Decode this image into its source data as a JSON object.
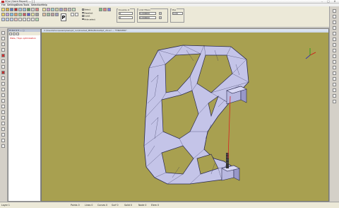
{
  "window": {
    "title": "SQui (Saint Report) — [ ]",
    "minimize_glyph": "–",
    "maximize_glyph": "□",
    "close_glyph": "✕"
  },
  "menu": [
    "File",
    "Settings",
    "Show",
    "Tools",
    "Selection",
    "Help"
  ],
  "toolbar": {
    "p_label": "P",
    "radios": [
      {
        "label": "Select",
        "selected": true
      },
      {
        "label": "Deselect",
        "selected": false
      },
      {
        "label": "Invert",
        "selected": false
      },
      {
        "label": "Hide select",
        "selected": false
      }
    ],
    "group_a_title": "Visualize id",
    "group_b_title": "Limit Filters",
    "group_c_title": "Max",
    "group_a_values": [
      "0",
      "0"
    ],
    "group_b_values": [
      "0.000000",
      "0.000000"
    ],
    "group_c_values": [
      "0.00"
    ]
  },
  "tree": {
    "header": "Pl-Sol 0.5 — ▢",
    "item": "Plate / Topo optimization"
  },
  "viewport": {
    "title": "C:\\Users\\Docs\\examples\\opt_run\\bracket_MMA\\ModelOpt_v6.sol  — *FINISHED*",
    "background": "#a8a050",
    "mesh_fill": "#c4c4e8",
    "mesh_line": "#2a2a50",
    "load_line": "#d82020",
    "axes": {
      "x": "#d01010",
      "y": "#10a010",
      "z": "#1010d0"
    }
  },
  "status": {
    "left": "Layer 1",
    "items": [
      "Points 0",
      "Lines 0",
      "Curves 0",
      "Surf 0",
      "Solid 0",
      "Node 0",
      "Elem 0"
    ]
  }
}
